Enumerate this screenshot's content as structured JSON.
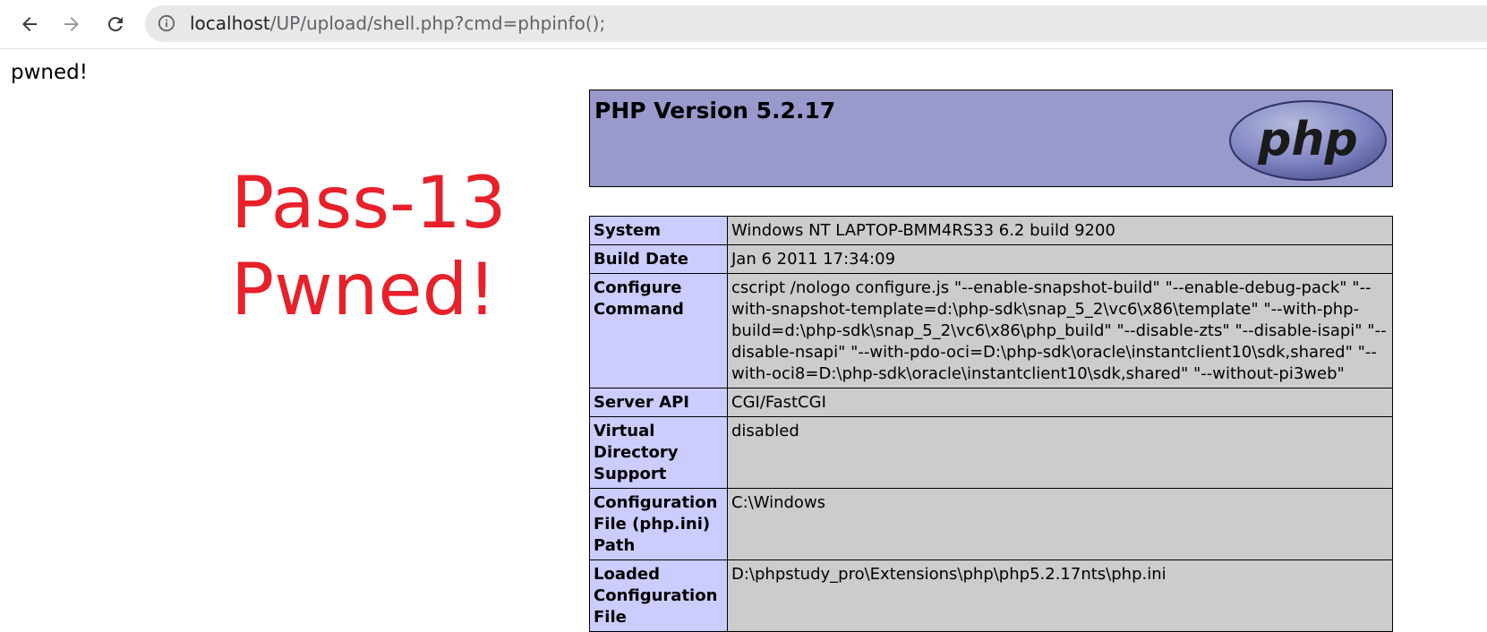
{
  "browser": {
    "url_host": "localhost",
    "url_path": "/UP/upload/shell.php?cmd=phpinfo();"
  },
  "page": {
    "pwned_text": "pwned!",
    "overlay_line1": "Pass-13",
    "overlay_line2": "Pwned!",
    "overlay_color": "#e8202a"
  },
  "phpinfo": {
    "version_title": "PHP Version 5.2.17",
    "logo_text": "php",
    "header_color": "#9999cc",
    "key_color": "#ccccff",
    "value_color": "#cccccc",
    "rows": [
      {
        "key": "System",
        "value": "Windows NT LAPTOP-BMM4RS33 6.2 build 9200"
      },
      {
        "key": "Build Date",
        "value": "Jan 6 2011 17:34:09"
      },
      {
        "key": "Configure Command",
        "value": "cscript /nologo configure.js \"--enable-snapshot-build\" \"--enable-debug-pack\" \"--with-snapshot-template=d:\\php-sdk\\snap_5_2\\vc6\\x86\\template\" \"--with-php-build=d:\\php-sdk\\snap_5_2\\vc6\\x86\\php_build\" \"--disable-zts\" \"--disable-isapi\" \"--disable-nsapi\" \"--with-pdo-oci=D:\\php-sdk\\oracle\\instantclient10\\sdk,shared\" \"--with-oci8=D:\\php-sdk\\oracle\\instantclient10\\sdk,shared\" \"--without-pi3web\""
      },
      {
        "key": "Server API",
        "value": "CGI/FastCGI"
      },
      {
        "key": "Virtual Directory Support",
        "value": "disabled"
      },
      {
        "key": "Configuration File (php.ini) Path",
        "value": "C:\\Windows"
      },
      {
        "key": "Loaded Configuration File",
        "value": "D:\\phpstudy_pro\\Extensions\\php\\php5.2.17nts\\php.ini"
      }
    ]
  }
}
